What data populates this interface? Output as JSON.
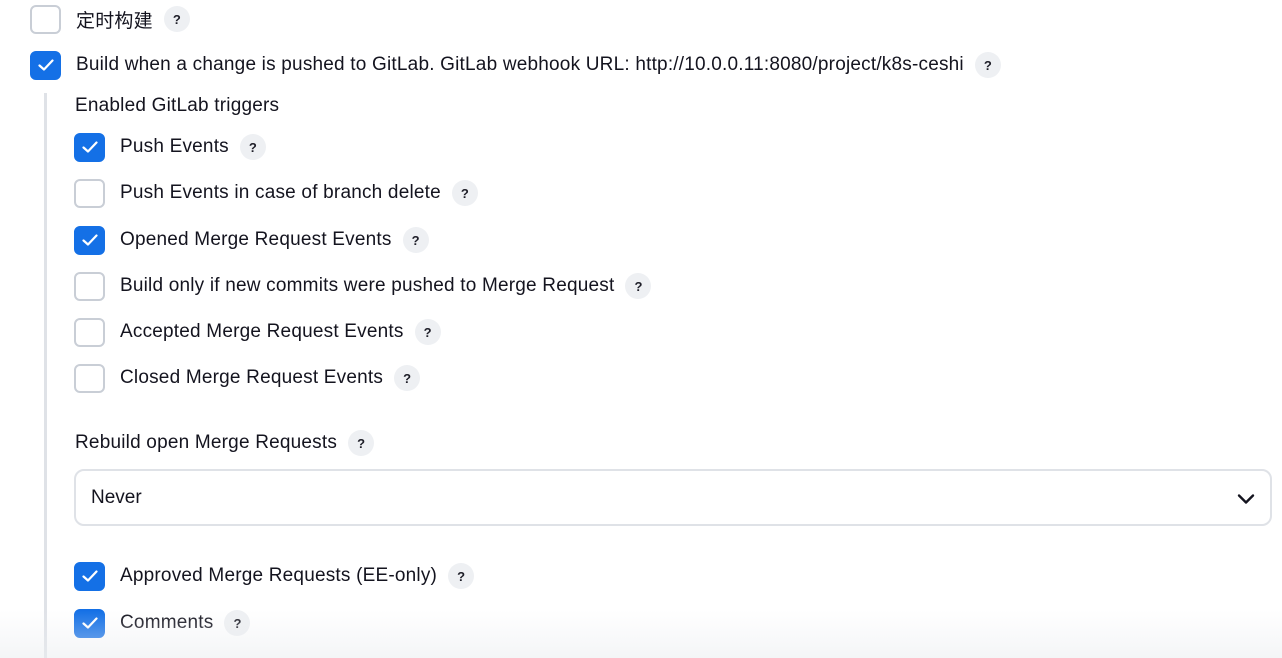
{
  "timer_build": {
    "label": "定时构建",
    "checked": false,
    "help": "?"
  },
  "gitlab_push_trigger": {
    "label": "Build when a change is pushed to GitLab. GitLab webhook URL: http://10.0.0.11:8080/project/k8s-ceshi",
    "checked": true,
    "help": "?"
  },
  "enabled_triggers_heading": "Enabled GitLab triggers",
  "triggers": [
    {
      "label": "Push Events",
      "checked": true,
      "help": "?"
    },
    {
      "label": "Push Events in case of branch delete",
      "checked": false,
      "help": "?"
    },
    {
      "label": "Opened Merge Request Events",
      "checked": true,
      "help": "?"
    },
    {
      "label": "Build only if new commits were pushed to Merge Request",
      "checked": false,
      "help": "?"
    },
    {
      "label": "Accepted Merge Request Events",
      "checked": false,
      "help": "?"
    },
    {
      "label": "Closed Merge Request Events",
      "checked": false,
      "help": "?"
    }
  ],
  "rebuild": {
    "label": "Rebuild open Merge Requests",
    "help": "?",
    "selected": "Never"
  },
  "extra_triggers": [
    {
      "label": "Approved Merge Requests (EE-only)",
      "checked": true,
      "help": "?"
    },
    {
      "label": "Comments",
      "checked": true,
      "help": "?"
    }
  ],
  "colors": {
    "accent": "#1470e6",
    "checkbox_border": "#c9ced6",
    "help_bg": "#eef0f3",
    "section_line": "#dfe2e7"
  }
}
